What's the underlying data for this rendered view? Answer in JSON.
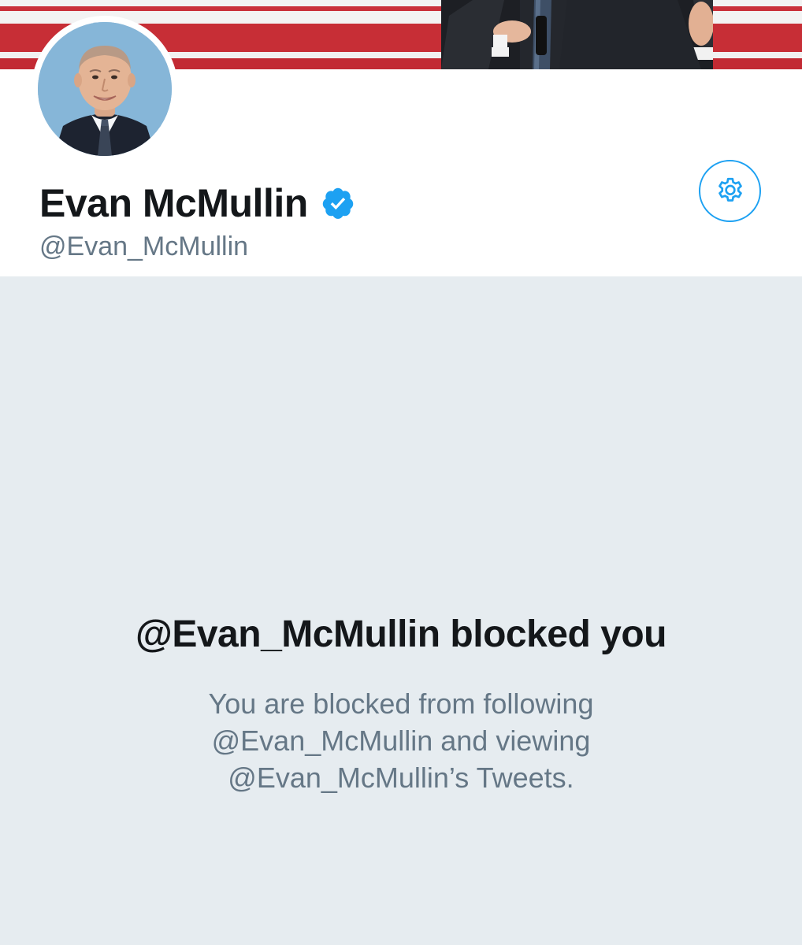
{
  "profile": {
    "display_name": "Evan McMullin",
    "handle": "@Evan_McMullin",
    "verified": true
  },
  "icons": {
    "settings": "gear-icon",
    "verified": "verified-badge-icon"
  },
  "blocked": {
    "title": "@Evan_McMullin blocked you",
    "line1": "You are blocked from following",
    "line2": "@Evan_McMullin and viewing",
    "line3": "@Evan_McMullin’s Tweets."
  },
  "colors": {
    "accent": "#1da1f2",
    "text_primary": "#14171a",
    "text_secondary": "#657786",
    "background": "#e6ecf0"
  }
}
